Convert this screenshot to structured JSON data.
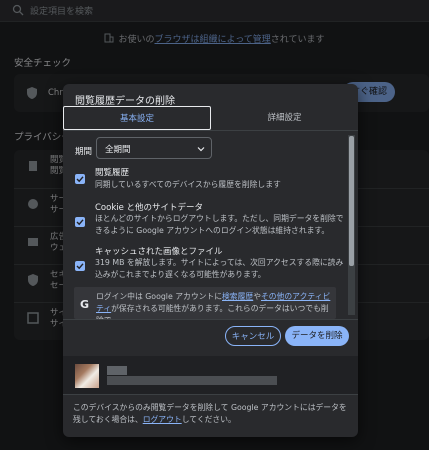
{
  "background": {
    "search_placeholder": "設定項目を検索",
    "managed_prefix": "お使いの",
    "managed_link": "ブラウザは組織によって管理",
    "managed_suffix": "されています",
    "safety_check_title": "安全チェック",
    "safety_row_text": "Chro",
    "safety_button": "すぐ確認",
    "privacy_title": "プライバシー",
    "rows": [
      "閲覧\n閲覧",
      "サー\nサー",
      "広告\nウェ",
      "セキ\nセー",
      "サイ\nサイ"
    ]
  },
  "dialog": {
    "title": "閲覧履歴データの削除",
    "tabs": {
      "basic": "基本設定",
      "advanced": "詳細設定"
    },
    "period": {
      "label": "期間",
      "value": "全期間"
    },
    "options": [
      {
        "title": "閲覧履歴",
        "desc": "同期しているすべてのデバイスから履歴を削除します",
        "checked": true
      },
      {
        "title": "Cookie と他のサイトデータ",
        "desc": "ほとんどのサイトからログアウトします。ただし、同期データを削除できるように Google アカウントへのログイン状態は維持されます。",
        "checked": true
      },
      {
        "title": "キャッシュされた画像とファイル",
        "desc": "319 MB を解放します。サイトによっては、次回アクセスする際に読み込みがこれまでより遅くなる可能性があります。",
        "checked": true
      }
    ],
    "info": {
      "text_1": "ログイン中は Google アカウントに",
      "link_1": "検索履歴",
      "text_2": "や",
      "link_2": "その他のアクティビティ",
      "text_3": "が保存される可能性があります。これらのデータはいつでも削除で"
    },
    "buttons": {
      "cancel": "キャンセル",
      "delete": "データを削除"
    },
    "note": {
      "text": "このデバイスからのみ閲覧データを削除して Google アカウントにはデータを残しておく場合は、",
      "link": "ログアウト",
      "suffix": "してください。"
    }
  },
  "colors": {
    "accent": "#8ab4f8",
    "surface": "#292a2d",
    "page": "#202124"
  }
}
